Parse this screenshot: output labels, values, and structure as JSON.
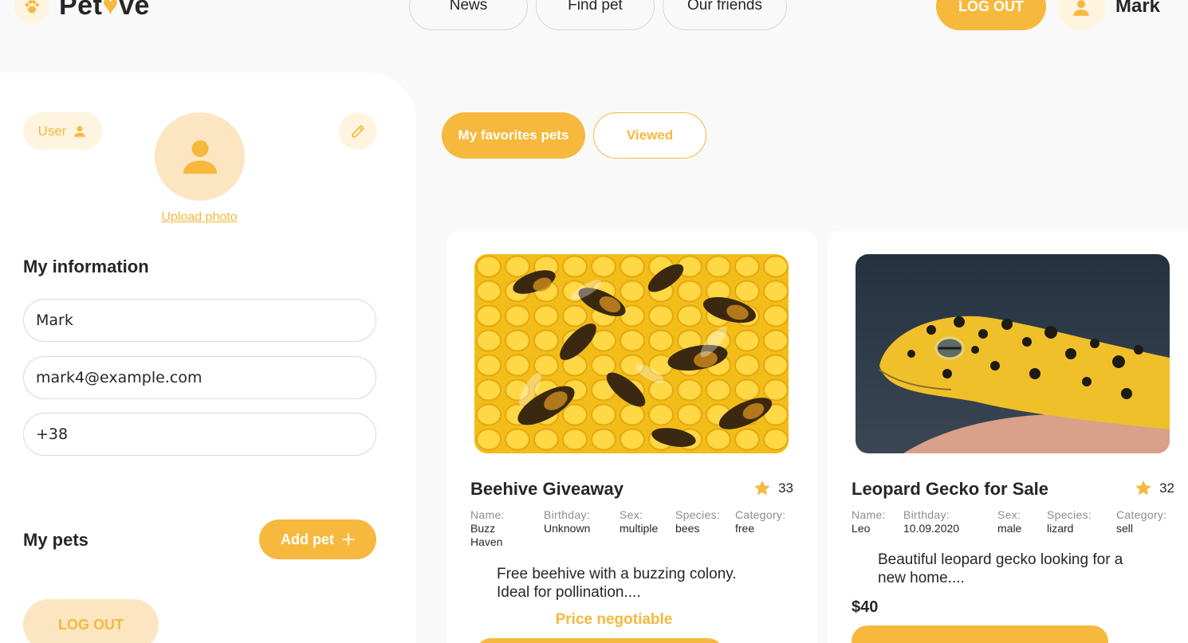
{
  "header": {
    "logo": {
      "prefix": "Pet",
      "heart": "♥",
      "suffix": "ve"
    },
    "nav": [
      "News",
      "Find pet",
      "Our friends"
    ],
    "logout_label": "LOG OUT",
    "username": "Mark"
  },
  "profile": {
    "user_badge": "User",
    "upload_label": "Upload photo",
    "info_title": "My information",
    "fields": {
      "name": "Mark",
      "email": "mark4@example.com",
      "phone": "+38"
    },
    "pets_title": "My pets",
    "add_pet_label": "Add pet",
    "logout_label": "LOG OUT"
  },
  "tabs": {
    "favorites": "My favorites pets",
    "viewed": "Viewed"
  },
  "cards": [
    {
      "title": "Beehive Giveaway",
      "popularity": "33",
      "details": {
        "name_k": "Name:",
        "name_v1": "Buzz",
        "name_v2": "Haven",
        "birthday_k": "Birthday:",
        "birthday_v": "Unknown",
        "sex_k": "Sex:",
        "sex_v": "multiple",
        "species_k": "Species:",
        "species_v": "bees",
        "category_k": "Category:",
        "category_v": "free"
      },
      "comment_1": "Free beehive with a buzzing colony.",
      "comment_2": "Ideal for pollination....",
      "price": "Price negotiable"
    },
    {
      "title": "Leopard Gecko for Sale",
      "popularity": "32",
      "details": {
        "name_k": "Name:",
        "name_v": "Leo",
        "birthday_k": "Birthday:",
        "birthday_v": "10.09.2020",
        "sex_k": "Sex:",
        "sex_v": "male",
        "species_k": "Species:",
        "species_v": "lizard",
        "category_k": "Category:",
        "category_v": "sell"
      },
      "comment_1": "Beautiful leopard gecko looking for a",
      "comment_2": "new home....",
      "price": "$40"
    }
  ],
  "colors": {
    "accent": "#f6b83d",
    "accent_light": "#fff4df",
    "background": "#f9f9f9",
    "text": "#262626"
  },
  "icons": [
    "paw-icon",
    "user-icon",
    "pencil-icon",
    "plus-icon",
    "star-icon"
  ]
}
